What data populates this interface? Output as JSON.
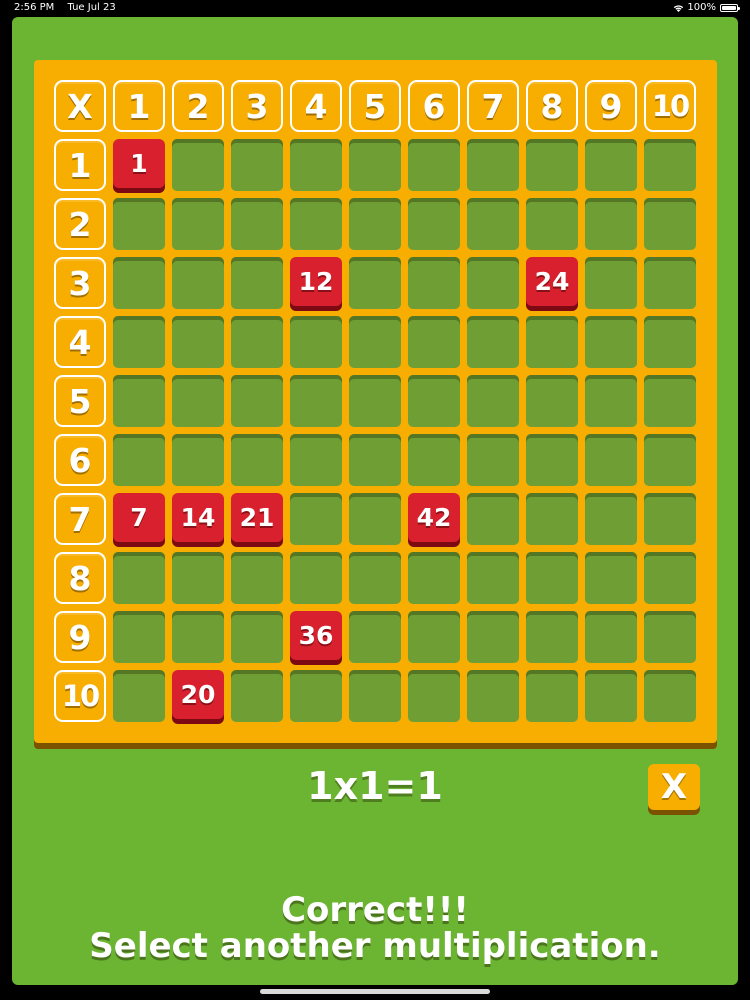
{
  "status_bar": {
    "time": "2:56 PM",
    "date": "Tue Jul 23",
    "battery": "100%",
    "wifi_icon": "wifi-icon",
    "battery_icon": "battery-icon"
  },
  "board": {
    "corner_label": "X",
    "column_headers": [
      "1",
      "2",
      "3",
      "4",
      "5",
      "6",
      "7",
      "8",
      "9",
      "10"
    ],
    "row_headers": [
      "1",
      "2",
      "3",
      "4",
      "5",
      "6",
      "7",
      "8",
      "9",
      "10"
    ],
    "answered_cells": [
      {
        "row": 1,
        "col": 1,
        "value": "1"
      },
      {
        "row": 3,
        "col": 4,
        "value": "12"
      },
      {
        "row": 3,
        "col": 8,
        "value": "24"
      },
      {
        "row": 7,
        "col": 1,
        "value": "7"
      },
      {
        "row": 7,
        "col": 2,
        "value": "14"
      },
      {
        "row": 7,
        "col": 3,
        "value": "21"
      },
      {
        "row": 7,
        "col": 6,
        "value": "42"
      },
      {
        "row": 9,
        "col": 4,
        "value": "36"
      },
      {
        "row": 10,
        "col": 2,
        "value": "20"
      }
    ]
  },
  "equation": "1x1=1",
  "close_button": {
    "label": "X"
  },
  "message": {
    "line1": "Correct!!!",
    "line2": "Select another multiplication."
  },
  "colors": {
    "background": "#6cb533",
    "board": "#f7ae00",
    "answered": "#d9202e",
    "empty_cell": "#6f9f34"
  }
}
